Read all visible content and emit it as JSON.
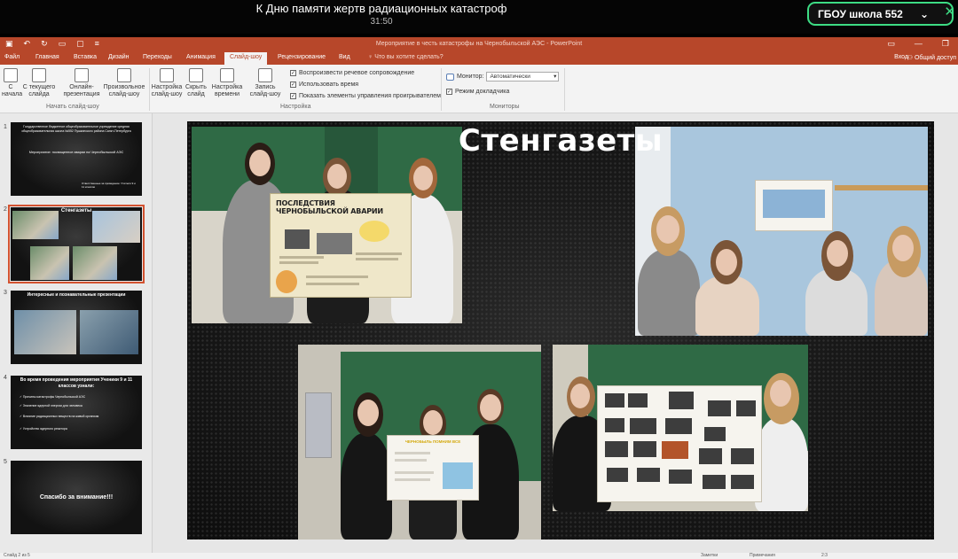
{
  "meeting": {
    "title": "К Дню памяти жертв радиационных катастроф",
    "timer": "31:50",
    "channel": "ГБОУ школа 552"
  },
  "powerpoint": {
    "document_title": "Мероприятие в честь катастрофы на Чернобыльской АЭС - PowerPoint",
    "tabs": [
      "Файл",
      "Главная",
      "Вставка",
      "Дизайн",
      "Переходы",
      "Анимация",
      "Слайд-шоу",
      "Рецензирование",
      "Вид"
    ],
    "active_tab": "Слайд-шоу",
    "tell_me": "Что вы хотите сделать?",
    "sign_in": "Вход",
    "share": "Общий доступ",
    "ribbon": {
      "start_group": {
        "label": "Начать слайд-шоу",
        "buttons": [
          "С начала",
          "С текущего слайда",
          "Онлайн-презентация",
          "Произвольное слайд-шоу"
        ]
      },
      "setup_group": {
        "label": "Настройка",
        "buttons": [
          "Настройка слайд-шоу",
          "Скрыть слайд",
          "Настройка времени",
          "Запись слайд-шоу"
        ],
        "checks": [
          {
            "label": "Воспроизвести речевое сопровождение",
            "checked": true
          },
          {
            "label": "Использовать время",
            "checked": true
          },
          {
            "label": "Показать элементы управления проигрывателем",
            "checked": true
          }
        ]
      },
      "monitors_group": {
        "label": "Мониторы",
        "monitor_label": "Монитор:",
        "monitor_value": "Автоматически",
        "presenter_label": "Режим докладчика",
        "presenter_checked": true
      }
    },
    "slides": [
      {
        "num": "1",
        "lines": [
          "Государственное бюджетное общеобразовательное учреждение средняя общеобразовательная школа №552 Пушкинского района Санкт-Петербурга",
          "Мероприятие: посвященное аварии на Чернобыльской АЭС",
          "Ответственные за проведение: Учителя 9 и 11 классов"
        ]
      },
      {
        "num": "2",
        "title": "Стенгазеты"
      },
      {
        "num": "3",
        "title": "Интересные и познавательные презентации"
      },
      {
        "num": "4",
        "title": "Во время проведения мероприятия Ученики 9 и 11 классов узнали:",
        "lines": [
          "✓ Причины катастрофы Чернобыльской АЭС",
          "✓ Значение ядерной энергии для человека",
          "✓ Влияние радиационных веществ на живой организм",
          "✓ Устройство ядерного реактора"
        ]
      },
      {
        "num": "5",
        "title": "Спасибо за внимание!!!"
      }
    ],
    "current_slide": {
      "title": "Стенгазеты",
      "poster_title": "ПОСЛЕДСТВИЯ ЧЕРНОБЫЛЬСКОЙ АВАРИИ",
      "poster2_title": "ЧЕРНОБЫЛЬ ПОМНИМ ВСЕ"
    },
    "status": {
      "slide_count": "Слайд 2 из 5",
      "notes": "Заметки",
      "comments": "Примечания",
      "zoom_ratio": "2:3"
    }
  }
}
